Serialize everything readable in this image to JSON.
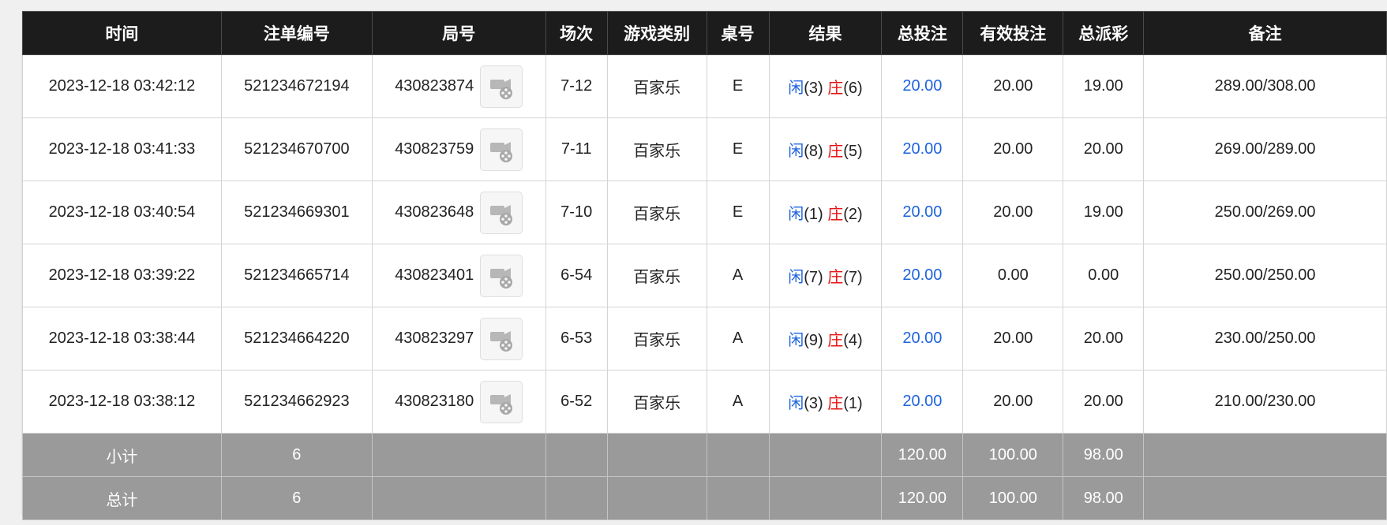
{
  "table": {
    "headers": [
      "时间",
      "注单编号",
      "局号",
      "场次",
      "游戏类别",
      "桌号",
      "结果",
      "总投注",
      "有效投注",
      "总派彩",
      "备注"
    ],
    "rows": [
      {
        "time": "2023-12-18 03:42:12",
        "bet_id": "521234672194",
        "round": "430823874",
        "session": "7-12",
        "game": "百家乐",
        "table": "E",
        "result": {
          "player_label": "闲",
          "player": "(3)",
          "banker_label": "庄",
          "banker": "(6)"
        },
        "total_bet": "20.00",
        "valid_bet": "20.00",
        "payout": "19.00",
        "note": "289.00/308.00"
      },
      {
        "time": "2023-12-18 03:41:33",
        "bet_id": "521234670700",
        "round": "430823759",
        "session": "7-11",
        "game": "百家乐",
        "table": "E",
        "result": {
          "player_label": "闲",
          "player": "(8)",
          "banker_label": "庄",
          "banker": "(5)"
        },
        "total_bet": "20.00",
        "valid_bet": "20.00",
        "payout": "20.00",
        "note": "269.00/289.00"
      },
      {
        "time": "2023-12-18 03:40:54",
        "bet_id": "521234669301",
        "round": "430823648",
        "session": "7-10",
        "game": "百家乐",
        "table": "E",
        "result": {
          "player_label": "闲",
          "player": "(1)",
          "banker_label": "庄",
          "banker": "(2)"
        },
        "total_bet": "20.00",
        "valid_bet": "20.00",
        "payout": "19.00",
        "note": "250.00/269.00"
      },
      {
        "time": "2023-12-18 03:39:22",
        "bet_id": "521234665714",
        "round": "430823401",
        "session": "6-54",
        "game": "百家乐",
        "table": "A",
        "result": {
          "player_label": "闲",
          "player": "(7)",
          "banker_label": "庄",
          "banker": "(7)"
        },
        "total_bet": "20.00",
        "valid_bet": "0.00",
        "payout": "0.00",
        "note": "250.00/250.00"
      },
      {
        "time": "2023-12-18 03:38:44",
        "bet_id": "521234664220",
        "round": "430823297",
        "session": "6-53",
        "game": "百家乐",
        "table": "A",
        "result": {
          "player_label": "闲",
          "player": "(9)",
          "banker_label": "庄",
          "banker": "(4)"
        },
        "total_bet": "20.00",
        "valid_bet": "20.00",
        "payout": "20.00",
        "note": "230.00/250.00"
      },
      {
        "time": "2023-12-18 03:38:12",
        "bet_id": "521234662923",
        "round": "430823180",
        "session": "6-52",
        "game": "百家乐",
        "table": "A",
        "result": {
          "player_label": "闲",
          "player": "(3)",
          "banker_label": "庄",
          "banker": "(1)"
        },
        "total_bet": "20.00",
        "valid_bet": "20.00",
        "payout": "20.00",
        "note": "210.00/230.00"
      }
    ],
    "subtotal": {
      "label": "小计",
      "count": "6",
      "total_bet": "120.00",
      "valid_bet": "100.00",
      "payout": "98.00"
    },
    "grand_total": {
      "label": "总计",
      "count": "6",
      "total_bet": "120.00",
      "valid_bet": "100.00",
      "payout": "98.00"
    }
  },
  "icons": {
    "replay": "video-replay-icon"
  },
  "colors": {
    "header_bg": "#1c1c1c",
    "footer_bg": "#9a9a9a",
    "player": "#1e63dd",
    "banker": "#e51414",
    "total_bet": "#1e63dd"
  }
}
